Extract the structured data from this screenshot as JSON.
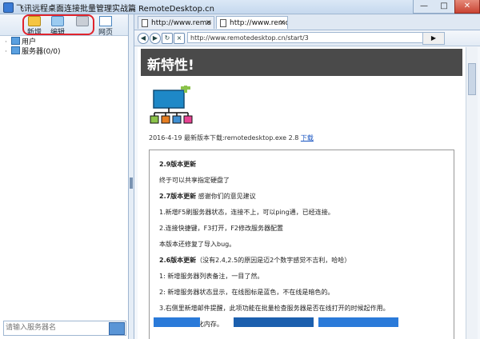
{
  "window": {
    "title": "飞讯远程桌面连接批量管理实战篇 RemoteDesktop.cn",
    "minimize": "—",
    "maximize": "□",
    "close": "✕"
  },
  "toolbar": {
    "new_label": "新增",
    "edit_label": "编辑",
    "delete_label": "",
    "web_label": "网页"
  },
  "tree": {
    "users_label": "用户",
    "servers_label": "服务器(0/0)"
  },
  "search": {
    "placeholder": "请输入服务器名"
  },
  "tabs": [
    {
      "label": "http://www.remo",
      "close": "×"
    },
    {
      "label": "http://www.remo",
      "close": "×"
    }
  ],
  "address": {
    "url": "http://www.remotedesktop.cn/start/3",
    "go_label": "▶"
  },
  "page": {
    "banner_title": "新特性!",
    "release_text": "2016-4-19 最新版本下载:remotedesktop.exe 2.8",
    "release_link": "下载",
    "notes": [
      {
        "bold": "2.9版本更新",
        "text": ""
      },
      {
        "bold": "",
        "text": "终于可以共享指定硬盘了"
      },
      {
        "bold": "2.7版本更新",
        "text": "  感谢你们的意见建议"
      },
      {
        "bold": "",
        "text": "1.新增F5刷服务器状态，连接不上，可以ping通，已经连接。"
      },
      {
        "bold": "",
        "text": "2.连接快捷键，F3打开，F2修改服务器配置"
      },
      {
        "bold": "",
        "text": "本版本还修复了导入bug。"
      },
      {
        "bold": "2.6版本更新",
        "text": "（没有2.4,2.5的原因是迈2个数字感觉不吉利，哈哈）"
      },
      {
        "bold": "",
        "text": "1:   新增服务器列表备注，一目了然。"
      },
      {
        "bold": "",
        "text": "2:   新增服务器状态显示，在线图标是蓝色，不在线是暗色的。"
      },
      {
        "bold": "",
        "text": "3.右侧里新增邮件提醒，此项功能在批量检查服务器是否在线打开的时候起作用。"
      },
      {
        "bold": "",
        "text": "4:   Tab切换优化内存。"
      }
    ]
  },
  "colors": {
    "highlight_box": "#e0242d",
    "banner_bg": "#4a4a4a",
    "logo_screen": "#1e88c7",
    "logo_plus": "#8bc34a"
  }
}
